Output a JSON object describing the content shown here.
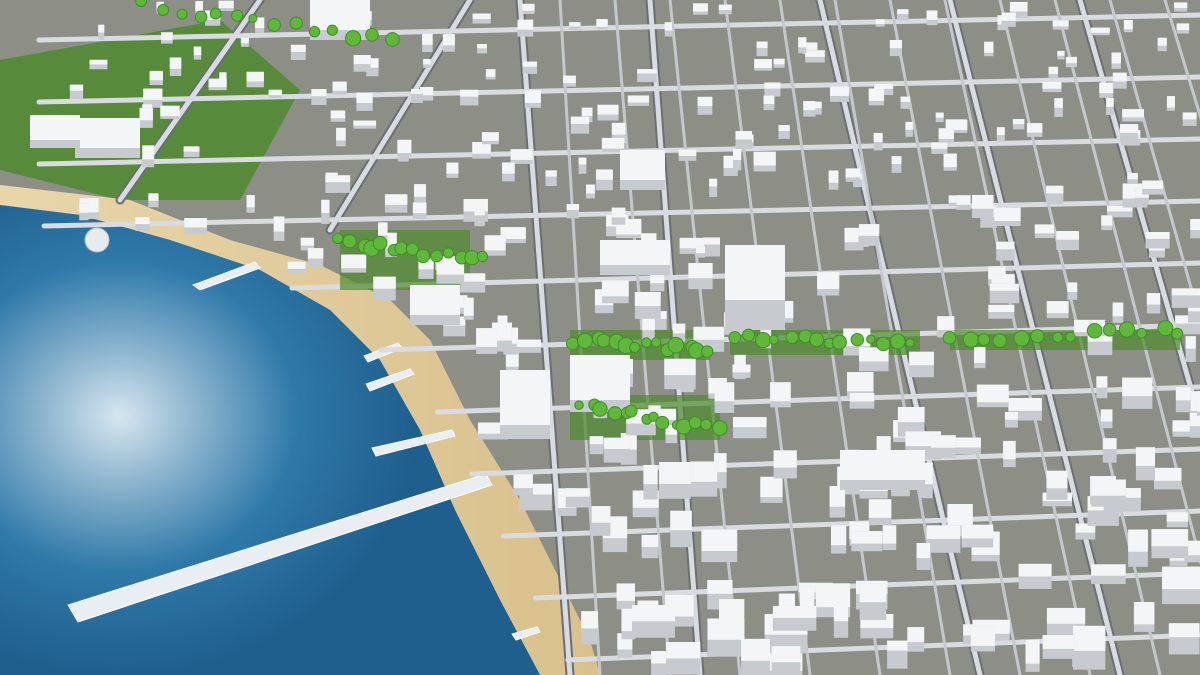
{
  "scene": {
    "kind": "3d-city-model-aerial-view",
    "description_visible_features": [
      "sea",
      "sandy-beach",
      "piers",
      "street-grid",
      "white-building-blocks",
      "green-tree-parks"
    ],
    "colors": {
      "sea_deep": "#1f5f8e",
      "sea_mid": "#2f79a9",
      "sea_shine": "#c9dce8",
      "beach": "#e3cf9f",
      "ground": "#8d8f86",
      "road": "#d8dce0",
      "road_dark": "#6b6f73",
      "building_top": "#f4f5f6",
      "building_side": "#c7cace",
      "tree": "#5fb83a",
      "grass": "#4f8a2e"
    }
  }
}
